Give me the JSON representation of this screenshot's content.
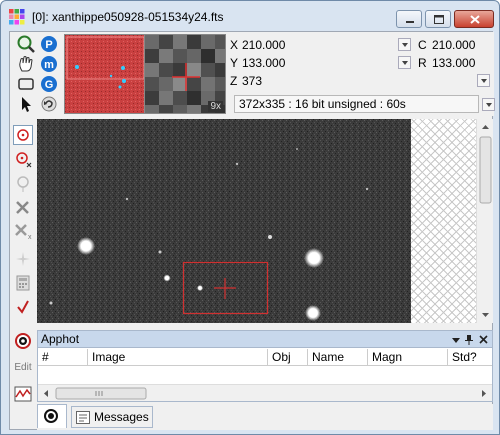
{
  "window": {
    "title": "[0]: xanthippe050928-051534y24.fts"
  },
  "coords": {
    "x_label": "X",
    "x_value": "210.000",
    "c_label": "C",
    "c_value": "210.000",
    "y_label": "Y",
    "y_value": "133.000",
    "r_label": "R",
    "r_value": "133.000",
    "z_label": "Z",
    "z_value": "373",
    "info": "372x335 : 16 bit unsigned : 60s"
  },
  "thumb": {
    "zoom_label": "9x"
  },
  "lefttools": {
    "edit_label": "Edit"
  },
  "apphot": {
    "title": "Apphot",
    "columns": [
      "#",
      "Image",
      "Obj",
      "Name",
      "Magn",
      "Std?"
    ]
  },
  "tabs": {
    "messages_label": "Messages"
  },
  "colors": {
    "title_bg": "#d9e4f1",
    "panel_header": "#c8d8ec",
    "box_red": "#d03030",
    "thumb_red": "#cc3b3b"
  }
}
